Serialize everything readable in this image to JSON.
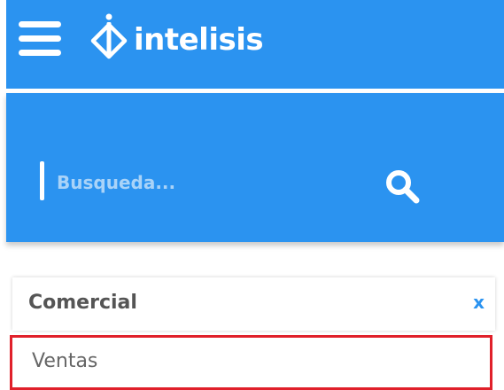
{
  "header": {
    "menu_icon": "hamburger-menu-icon",
    "brand": "intelisis",
    "logo_icon": "intelisis-logo-mark"
  },
  "search": {
    "placeholder": "Busqueda...",
    "value": "",
    "icon": "search-icon"
  },
  "category": {
    "title": "Comercial",
    "close_label": "x"
  },
  "menu": {
    "items": [
      {
        "label": "Ventas",
        "highlighted": true
      }
    ]
  },
  "colors": {
    "primary_blue": "#2b93f0",
    "highlight_red": "#e0202a",
    "close_blue": "#2b93f0",
    "placeholder_text": "#a9d3f8"
  }
}
